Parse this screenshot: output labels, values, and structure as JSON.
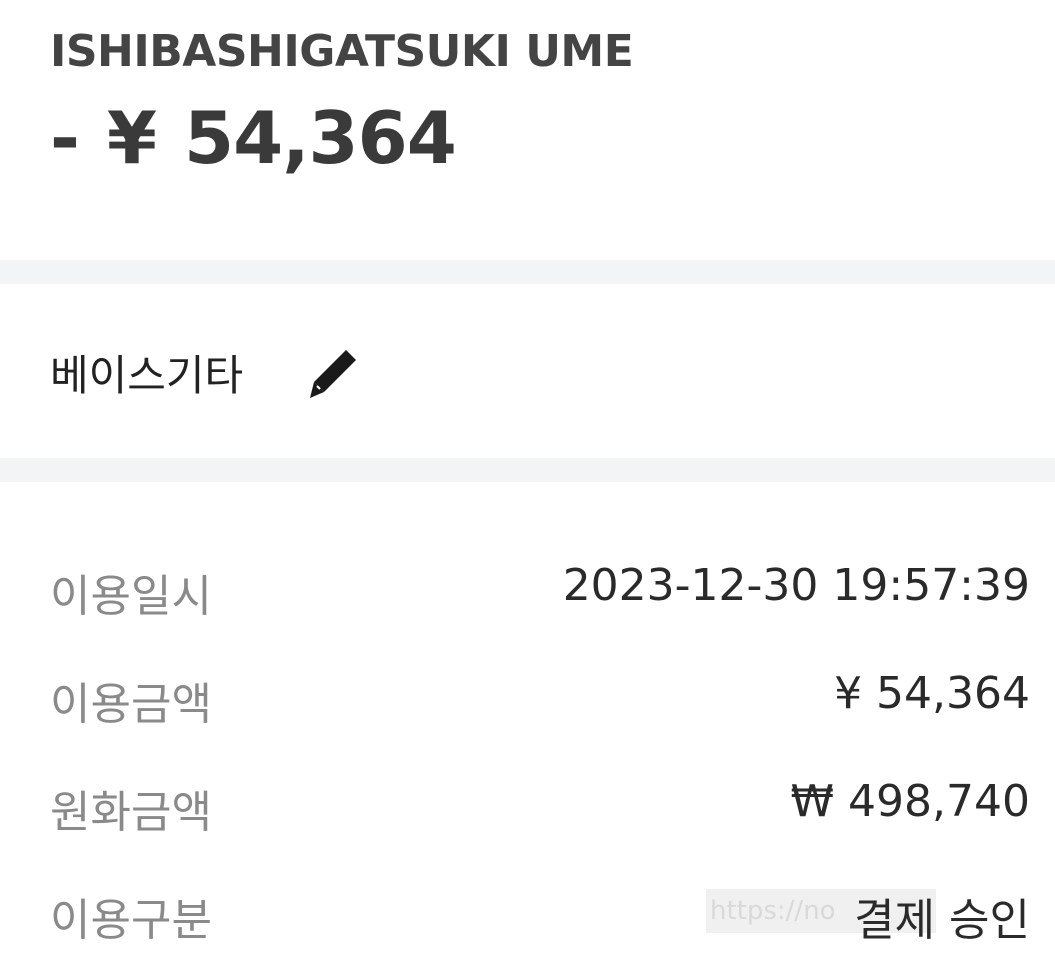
{
  "header": {
    "merchant_name": "ISHIBASHIGATSUKI UME",
    "amount_sign": "-",
    "amount_currency": "¥",
    "amount_value": "54,364"
  },
  "memo": {
    "text": "베이스기타",
    "edit_icon": "pencil-icon"
  },
  "details": {
    "rows": [
      {
        "label": "이용일시",
        "value": "2023-12-30 19:57:39"
      },
      {
        "label": "이용금액",
        "value": "¥ 54,364"
      },
      {
        "label": "원화금액",
        "value": "₩ 498,740"
      },
      {
        "label": "이용구분",
        "value": "결제 승인"
      }
    ]
  },
  "watermark": {
    "text": "https://no"
  },
  "colors": {
    "divider": "#f3f4f6",
    "label": "#8a8a8a",
    "value": "#2a2a2a",
    "title": "#444444"
  }
}
